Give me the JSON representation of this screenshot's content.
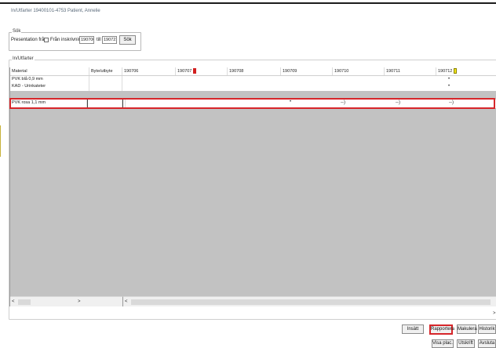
{
  "window": {
    "title": "In/Utfarter 19400101-4753 Patient, Annelie"
  },
  "search": {
    "group_label": "Sök",
    "presentation_label": "Presentation från",
    "from_admission_label": "Från inskrivning",
    "from_date": "190706",
    "to_label": "till",
    "to_date": "190721",
    "search_button": "Sök"
  },
  "grid": {
    "group_label": "In/Utfarter",
    "columns": [
      "Material",
      "Byte/utbyte",
      "190706",
      "190707",
      "190708",
      "190709",
      "190710",
      "190711",
      "190712"
    ],
    "flags": {
      "190707": "#d21f1f",
      "190712": "#f2e61a"
    },
    "rows": [
      {
        "material": "PVK blå 0,9 mm",
        "marks": {
          "190712": "•"
        }
      },
      {
        "material": "KAD - Urinkateter",
        "marks": {
          "190712": "•"
        }
      },
      {
        "material": "PVK rosa 1,1 mm",
        "marks": {
          "190709": "•",
          "190710": "--)",
          "190711": "--)",
          "190712": "--)"
        }
      }
    ]
  },
  "scroll": {
    "left_arrow": "<",
    "right_arrow": ">",
    "right_panel_left_arrow": "<",
    "far_right_arrow": ">"
  },
  "buttons": {
    "insatt": "Insätt",
    "rapportera": "Rapportera",
    "makulera": "Makulera",
    "historik": "Historik",
    "visa_plac": "Visa plac.",
    "utskrift": "Utskrift",
    "avsluta": "Avsluta"
  },
  "colors": {
    "highlight": "#d6262a",
    "grid_background": "#c2c2c2"
  }
}
